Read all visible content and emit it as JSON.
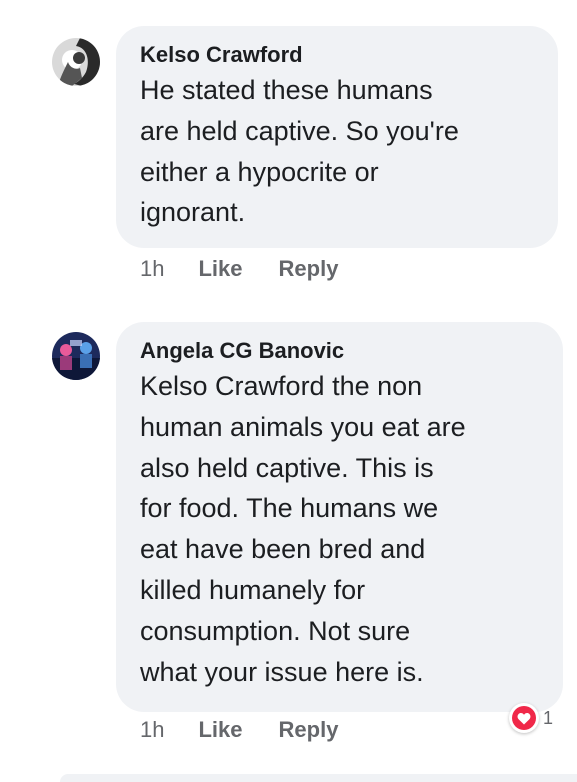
{
  "comments": [
    {
      "author": "Kelso Crawford",
      "lines": [
        "He stated these humans",
        "are held captive. So you're",
        "either a hypocrite or",
        "ignorant."
      ],
      "time": "1h",
      "like_label": "Like",
      "reply_label": "Reply"
    },
    {
      "author": "Angela CG Banovic",
      "lines": [
        "Kelso Crawford the non",
        "human animals you eat are",
        "also held captive. This is",
        "for food. The humans we",
        "eat have been bred and",
        "killed humanely for",
        "consumption. Not sure",
        "what your issue here is."
      ],
      "time": "1h",
      "like_label": "Like",
      "reply_label": "Reply",
      "reaction_icon": "heart-icon",
      "reaction_count": "1"
    }
  ],
  "colors": {
    "bubble": "#f0f2f5",
    "text": "#1c1e21",
    "meta": "#65676b",
    "heart": "#f02849"
  }
}
